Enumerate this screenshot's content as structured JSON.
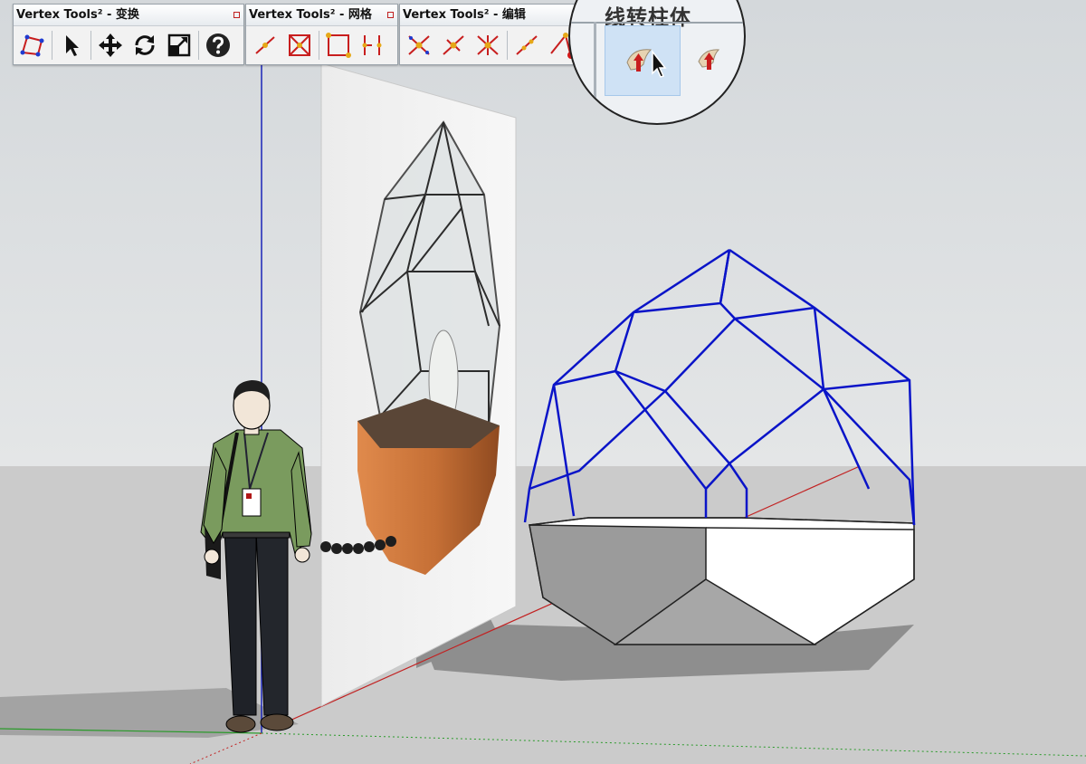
{
  "toolbars": [
    {
      "title": "Vertex Tools² - 变换",
      "buttons": [
        "polygon-select-icon",
        "select-arrow-icon",
        "move-icon",
        "rotate-icon",
        "scale-icon",
        "help-icon"
      ]
    },
    {
      "title": "Vertex Tools² - 网格",
      "buttons": [
        "line-vertex-icon",
        "box-cross-icon",
        "square-vertex-icon",
        "edge-split-icon"
      ]
    },
    {
      "title": "Vertex Tools² - 编辑",
      "buttons": [
        "merge-vertices-icon",
        "collapse-edge-icon",
        "weld-vertices-icon",
        "extend-line-icon",
        "vertex-edit-icon"
      ]
    }
  ],
  "magnifier": {
    "title": "线转柱体",
    "buttons": [
      "line-to-cylinder-icon",
      "line-to-cylinder-alt-icon"
    ]
  },
  "colors": {
    "ground": "#cfcfcf",
    "sky": "#dcdfe1",
    "wireframe": "#0a14c8",
    "wood": "#c9773f",
    "axis_red": "#c22222",
    "axis_green": "#2a9a2a",
    "axis_blue": "#1a24b8"
  }
}
